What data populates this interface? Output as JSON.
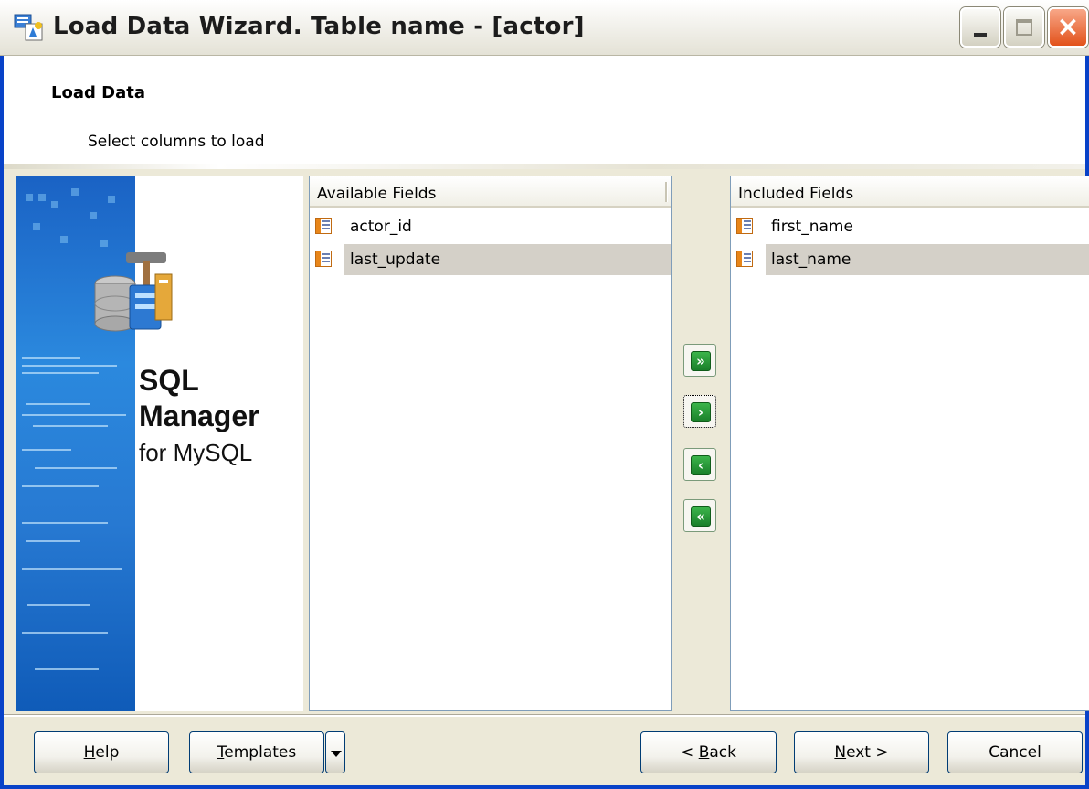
{
  "window": {
    "title": "Load Data Wizard. Table name - [actor]",
    "minimize_label": "",
    "maximize_label": "",
    "close_label": "×"
  },
  "header": {
    "title": "Load Data",
    "subtitle": "Select columns to load"
  },
  "banner": {
    "brand_line1": "SQL",
    "brand_line2": "Manager",
    "brand_line3": "for MySQL"
  },
  "available": {
    "header": "Available Fields",
    "items": [
      {
        "label": "actor_id",
        "selected": false
      },
      {
        "label": "last_update",
        "selected": true
      }
    ]
  },
  "included": {
    "header": "Included Fields",
    "items": [
      {
        "label": "first_name",
        "selected": false
      },
      {
        "label": "last_name",
        "selected": true
      }
    ]
  },
  "move_buttons": {
    "add_all": "»",
    "add": "›",
    "remove": "‹",
    "remove_all": "«"
  },
  "footer": {
    "help_first": "H",
    "help_rest": "elp",
    "templates_first": "T",
    "templates_rest": "emplates",
    "back_prefix": "< ",
    "back_first": "B",
    "back_rest": "ack",
    "next_first": "N",
    "next_rest": "ext >",
    "cancel": "Cancel"
  },
  "colors": {
    "selection": "#d4d0c8",
    "window_frame": "#0842c8",
    "strip": "#2b89de"
  }
}
